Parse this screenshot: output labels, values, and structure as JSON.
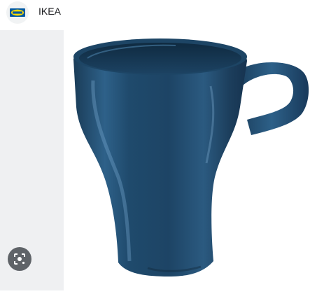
{
  "header": {
    "site_name": "IKEA",
    "logo_icon": "ikea-logo-icon",
    "logo_colors": {
      "blue": "#0058a3",
      "yellow": "#ffdb00"
    }
  },
  "main_image": {
    "subject_icon": "mug-icon",
    "mug_color": "#1f4867"
  },
  "controls": {
    "lens_icon": "visual-search-icon"
  }
}
